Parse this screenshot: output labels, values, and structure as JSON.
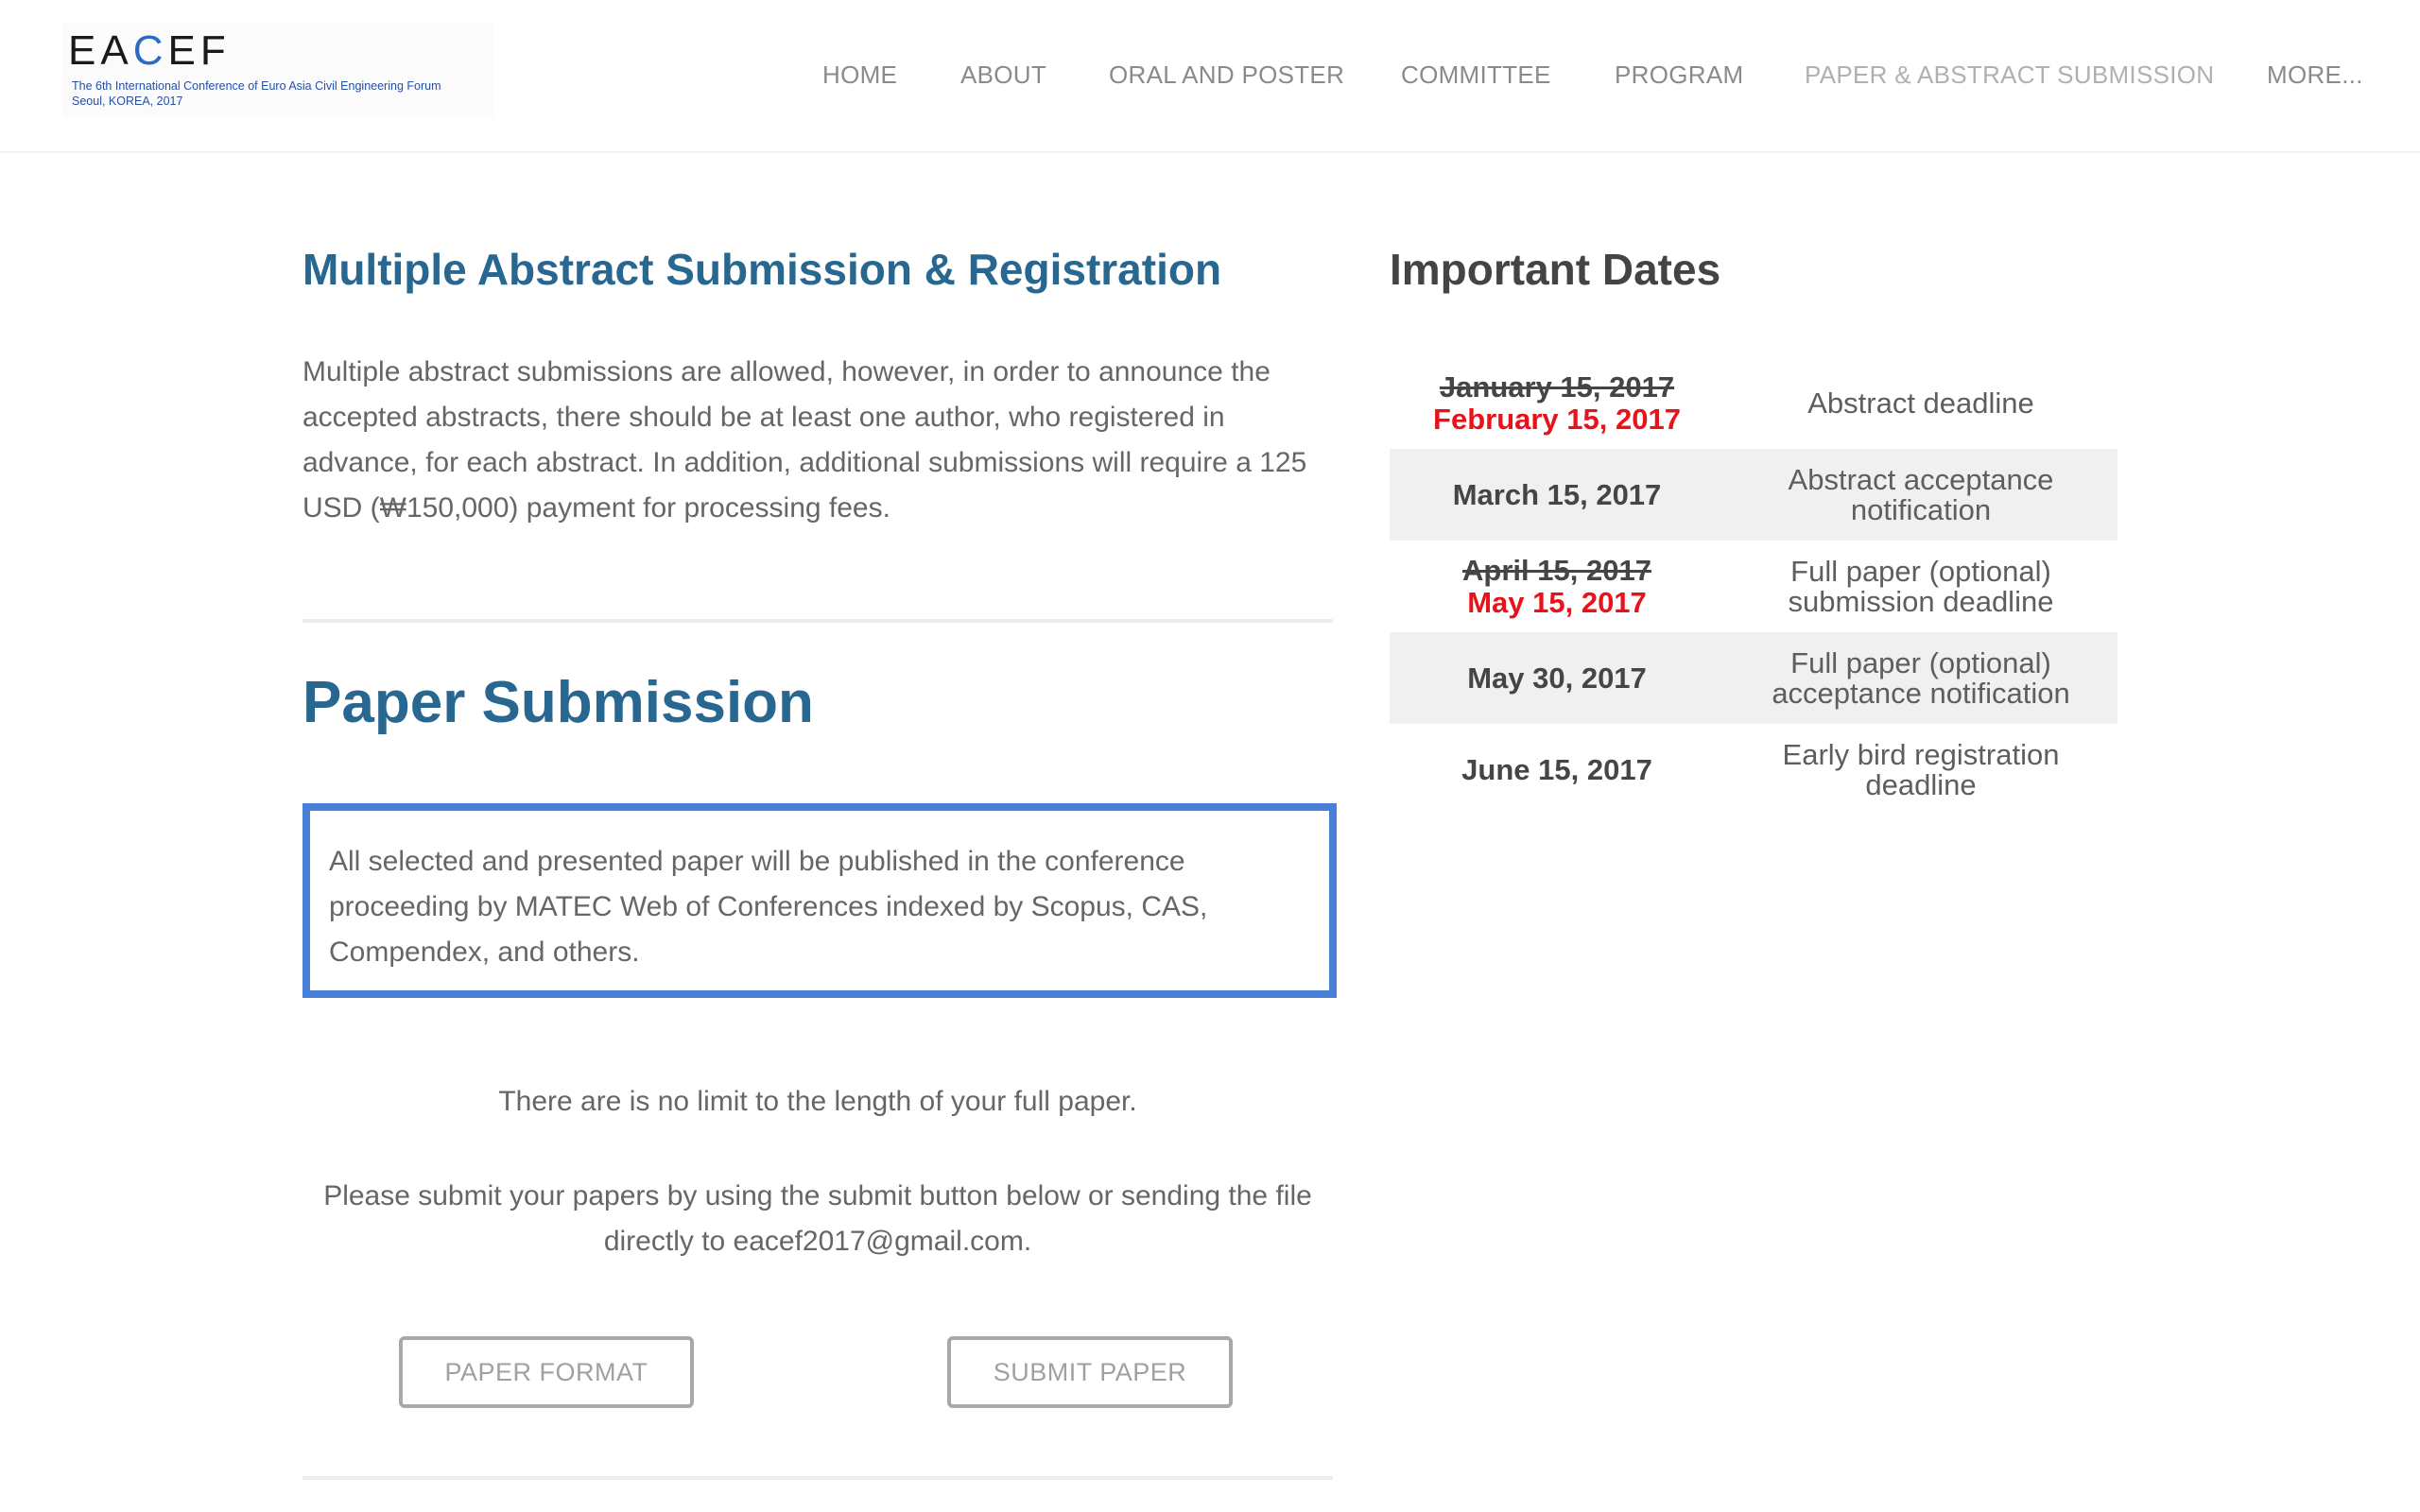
{
  "logo": {
    "text_prefix": "EA",
    "text_accent": "C",
    "text_suffix": "EF",
    "subtitle_line1": "The 6th International Conference of Euro Asia Civil Engineering Forum",
    "subtitle_line2": "Seoul, KOREA, 2017"
  },
  "nav": {
    "items": [
      {
        "label": "HOME"
      },
      {
        "label": "ABOUT"
      },
      {
        "label": "ORAL AND POSTER"
      },
      {
        "label": "COMMITTEE"
      },
      {
        "label": "PROGRAM"
      },
      {
        "label": "PAPER & ABSTRACT SUBMISSION"
      },
      {
        "label": "MORE..."
      }
    ],
    "active_item": "PAPER & ABSTRACT SUBMISSION"
  },
  "abstract_section": {
    "title": "Multiple Abstract Submission & Registration",
    "text": "Multiple abstract submissions are allowed, however, in order to announce the accepted abstracts, there should be at least one author, who registered in advance, for each abstract. In addition,  additional submissions will require a 125 USD (₩150,000) payment for processing fees."
  },
  "paper_section": {
    "title": "Paper Submission",
    "callout": "All selected and presented paper will be published in the conference proceeding by MATEC Web of Conferences indexed by Scopus, CAS, Compendex, and others.",
    "no_limit": "There are is no limit to the length of your full paper.",
    "submit_note": "Please submit your papers by using the submit button below or sending the file directly to eacef2017@gmail.com.",
    "buttons": {
      "format": "PAPER FORMAT",
      "submit": "SUBMIT PAPER"
    }
  },
  "important_dates": {
    "title": "Important Dates",
    "rows": [
      {
        "old_date": "January 15, 2017",
        "date": "February 15, 2017",
        "event": "Abstract deadline"
      },
      {
        "old_date": "",
        "date": "March 15, 2017",
        "event": "Abstract acceptance notification"
      },
      {
        "old_date": "April 15, 2017",
        "date": "May 15, 2017",
        "event": "Full paper (optional) submission deadline"
      },
      {
        "old_date": "",
        "date": "May 30, 2017",
        "event": "Full paper (optional) acceptance notification"
      },
      {
        "old_date": "",
        "date": "June 15, 2017",
        "event": "Early bird registration deadline"
      }
    ]
  },
  "colors": {
    "heading_blue": "#28678f",
    "callout_border": "#4a7fd6",
    "changed_date_red": "#e8121a",
    "row_shade": "#f0f0f0"
  }
}
